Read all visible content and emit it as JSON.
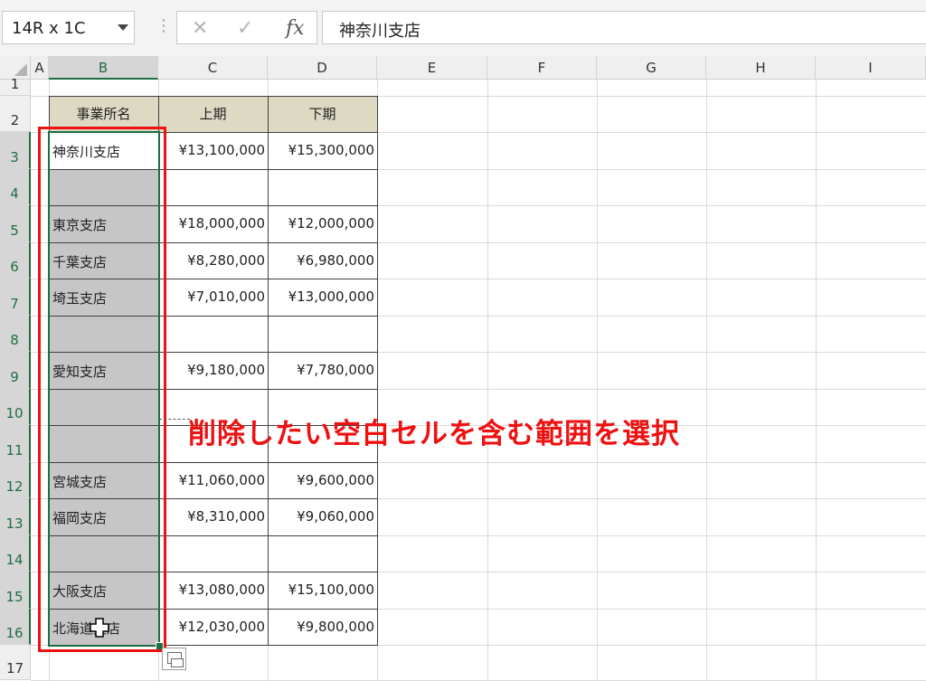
{
  "formula_bar": {
    "name_box": "14R x 1C",
    "cancel_icon": "✕",
    "enter_icon": "✓",
    "fx_label": "fx",
    "content": "神奈川支店"
  },
  "columns": [
    "A",
    "B",
    "C",
    "D",
    "E",
    "F",
    "G",
    "H",
    "I"
  ],
  "rows": [
    "1",
    "2",
    "3",
    "4",
    "5",
    "6",
    "7",
    "8",
    "9",
    "10",
    "11",
    "12",
    "13",
    "14",
    "15",
    "16",
    "17"
  ],
  "table": {
    "headers": [
      "事業所名",
      "上期",
      "下期"
    ],
    "rows": [
      {
        "name": "神奈川支店",
        "h1": "¥13,100,000",
        "h2": "¥15,300,000"
      },
      {
        "name": "",
        "h1": "",
        "h2": ""
      },
      {
        "name": "東京支店",
        "h1": "¥18,000,000",
        "h2": "¥12,000,000"
      },
      {
        "name": "千葉支店",
        "h1": "¥8,280,000",
        "h2": "¥6,980,000"
      },
      {
        "name": "埼玉支店",
        "h1": "¥7,010,000",
        "h2": "¥13,000,000"
      },
      {
        "name": "",
        "h1": "",
        "h2": ""
      },
      {
        "name": "愛知支店",
        "h1": "¥9,180,000",
        "h2": "¥7,780,000"
      },
      {
        "name": "",
        "h1": "",
        "h2": ""
      },
      {
        "name": "",
        "h1": "",
        "h2": ""
      },
      {
        "name": "宮城支店",
        "h1": "¥11,060,000",
        "h2": "¥9,600,000"
      },
      {
        "name": "福岡支店",
        "h1": "¥8,310,000",
        "h2": "¥9,060,000"
      },
      {
        "name": "",
        "h1": "",
        "h2": ""
      },
      {
        "name": "大阪支店",
        "h1": "¥13,080,000",
        "h2": "¥15,100,000"
      },
      {
        "name": "北海道支店",
        "h1": "¥12,030,000",
        "h2": "¥9,800,000"
      }
    ]
  },
  "annotation": "削除したい空白セルを含む範囲を選択",
  "colors": {
    "selection": "#1f6e43",
    "annotation": "#ee1111",
    "header_fill": "#ddd9c3",
    "selected_fill": "#c6c6c6"
  },
  "icons": {
    "quick_analysis": "quick-analysis-icon",
    "cursor": "plus-cursor-icon"
  }
}
